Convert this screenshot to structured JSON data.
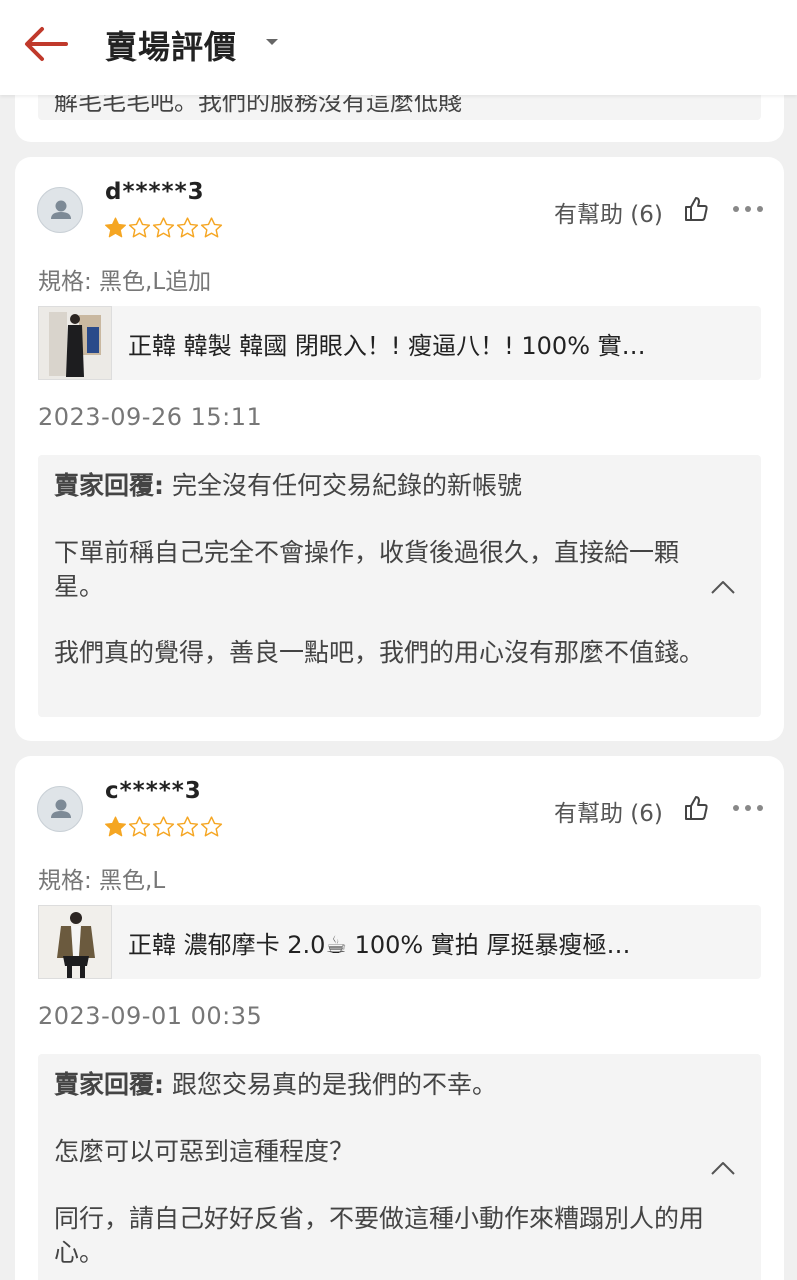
{
  "header": {
    "title": "賣場評價",
    "back_icon": "back-arrow-icon",
    "accent": "#c0392b"
  },
  "previous_reply_fragment": "解毛毛毛吧。我們的服務沒有這麼低賤",
  "reviews": [
    {
      "username": "d*****3",
      "rating": 1,
      "max_rating": 5,
      "helpful_label": "有幫助 (6)",
      "spec": "規格: 黑色,L追加",
      "product_name": "正韓 韓製 韓國 閉眼入！! 瘦逼八！! 100% 實…",
      "date": "2023-09-26 15:11",
      "reply_label": "賣家回覆:",
      "reply_first": "完全沒有任何交易紀錄的新帳號",
      "reply_paragraphs": [
        "下單前稱自己完全不會操作，收貨後過很久，直接給一顆星。",
        "我們真的覺得，善良一點吧，我們的用心沒有那麼不值錢。"
      ]
    },
    {
      "username": "c*****3",
      "rating": 1,
      "max_rating": 5,
      "helpful_label": "有幫助 (6)",
      "spec": "規格: 黑色,L",
      "product_name": "正韓 濃郁摩卡 2.0☕ 100% 實拍 厚挺暴瘦極…",
      "date": "2023-09-01 00:35",
      "reply_label": "賣家回覆:",
      "reply_first": "跟您交易真的是我們的不幸。",
      "reply_paragraphs": [
        "怎麼可以可惡到這種程度？",
        "同行，請自己好好反省，不要做這種小動作來糟蹋別人的用心。"
      ]
    }
  ],
  "colors": {
    "star": "#f5a623",
    "background": "#f0f0f0",
    "reply_bg": "#f4f4f4"
  }
}
